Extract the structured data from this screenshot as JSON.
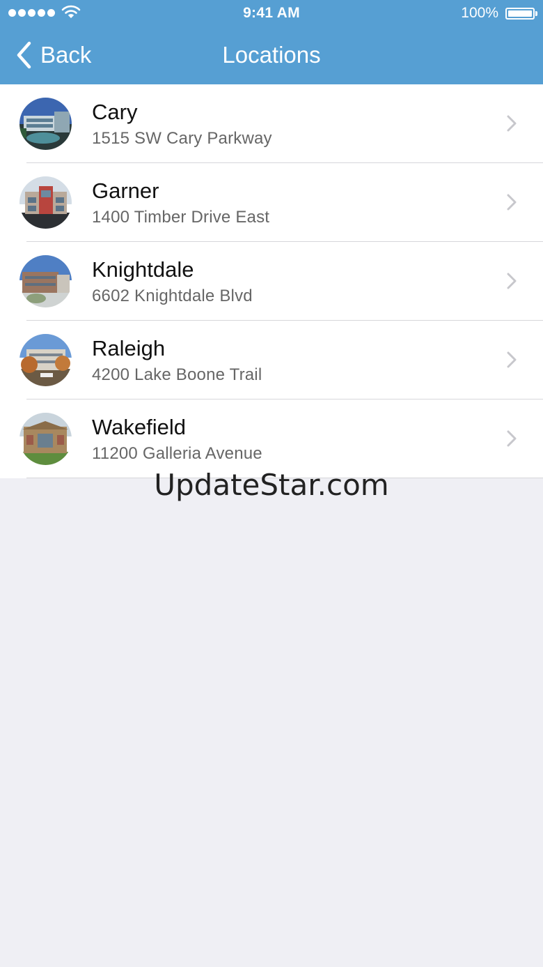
{
  "status_bar": {
    "time": "9:41 AM",
    "battery": "100%",
    "signal_icon": "signal-dots-icon",
    "wifi_icon": "wifi-icon",
    "battery_icon": "battery-icon"
  },
  "nav": {
    "back_label": "Back",
    "back_icon": "chevron-left-icon",
    "title": "Locations"
  },
  "colors": {
    "header_bg": "#569fd3",
    "list_bg": "#ffffff",
    "page_bg": "#efeff4",
    "subtitle_text": "#666666",
    "separator": "#d6d6da",
    "chevron": "#c7c7cc"
  },
  "locations": [
    {
      "name": "Cary",
      "address": "1515 SW Cary Parkway"
    },
    {
      "name": "Garner",
      "address": "1400 Timber Drive East"
    },
    {
      "name": "Knightdale",
      "address": "6602 Knightdale Blvd"
    },
    {
      "name": "Raleigh",
      "address": "4200 Lake Boone Trail"
    },
    {
      "name": "Wakefield",
      "address": "11200 Galleria Avenue"
    }
  ],
  "watermark": "UpdateStar.com"
}
